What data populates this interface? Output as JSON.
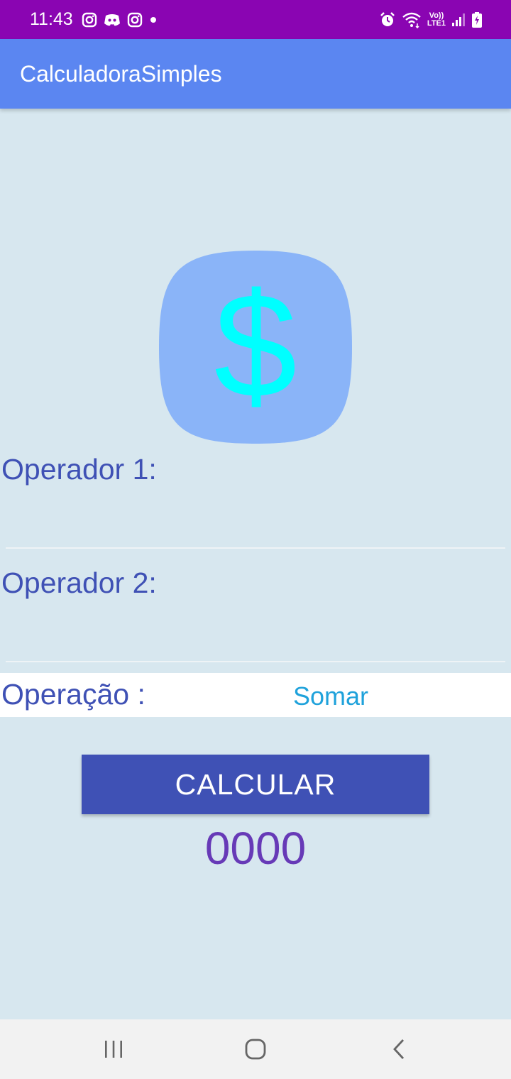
{
  "status_bar": {
    "time": "11:43",
    "left_icons": [
      "instagram-icon",
      "discord-icon",
      "instagram-icon",
      "notification-dot-icon"
    ],
    "right_icons": [
      "alarm-icon",
      "wifi-icon",
      "volte-lte-icon",
      "signal-icon",
      "battery-charging-icon"
    ],
    "lte_line1": "Vo))",
    "lte_line2": "LTE1"
  },
  "app_bar": {
    "title": "CalculadoraSimples"
  },
  "logo": {
    "icon": "dollar-icon",
    "background_color": "#8ab4f8",
    "symbol_color": "#00ffff"
  },
  "form": {
    "operador1_label": "Operador 1:",
    "operador1_value": "",
    "operador2_label": "Operador 2:",
    "operador2_value": "",
    "operacao_label": "Operação :",
    "operacao_selected": "Somar"
  },
  "actions": {
    "calcular_label": "CALCULAR"
  },
  "result": {
    "value": "0000"
  },
  "nav_bar": {
    "buttons": [
      "recent-apps-icon",
      "home-icon",
      "back-icon"
    ]
  },
  "colors": {
    "status_bar": "#8a05b2",
    "app_bar": "#5b86f1",
    "background": "#d7e7ef",
    "label": "#3f51b5",
    "spinner_text": "#1fa2db",
    "button": "#3f51b5",
    "result": "#673ab7"
  }
}
